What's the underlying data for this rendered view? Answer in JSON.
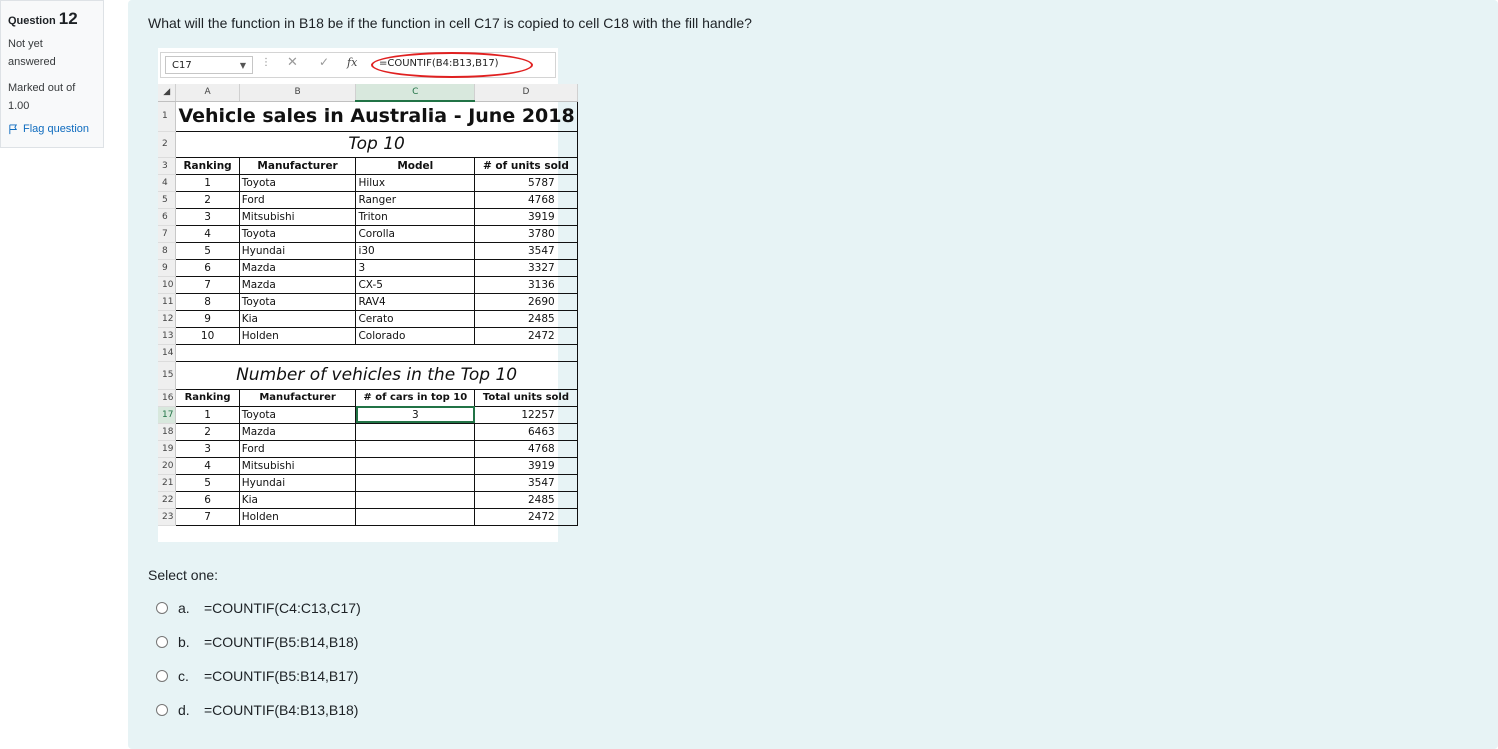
{
  "info": {
    "question_label": "Question",
    "question_number": "12",
    "state_line1": "Not yet",
    "state_line2": "answered",
    "grade_line1": "Marked out of",
    "grade_line2": "1.00",
    "flag_label": "Flag question",
    "flag_icon": "flag-icon"
  },
  "question_text": "What will the function in B18 be if the function in cell C17 is copied to cell C18 with the fill handle?",
  "excel": {
    "name_box": "C17",
    "formula": "=COUNTIF(B4:B13,B17)",
    "fx": "fx",
    "columns": [
      "A",
      "B",
      "C",
      "D"
    ],
    "title": "Vehicle sales in Australia - June 2018",
    "subtitle": "Top 10",
    "table1_headers": [
      "Ranking",
      "Manufacturer",
      "Model",
      "# of units sold"
    ],
    "table1_rows": [
      [
        "1",
        "Toyota",
        "Hilux",
        "5787"
      ],
      [
        "2",
        "Ford",
        "Ranger",
        "4768"
      ],
      [
        "3",
        "Mitsubishi",
        "Triton",
        "3919"
      ],
      [
        "4",
        "Toyota",
        "Corolla",
        "3780"
      ],
      [
        "5",
        "Hyundai",
        "i30",
        "3547"
      ],
      [
        "6",
        "Mazda",
        "3",
        "3327"
      ],
      [
        "7",
        "Mazda",
        "CX-5",
        "3136"
      ],
      [
        "8",
        "Toyota",
        "RAV4",
        "2690"
      ],
      [
        "9",
        "Kia",
        "Cerato",
        "2485"
      ],
      [
        "10",
        "Holden",
        "Colorado",
        "2472"
      ]
    ],
    "section2_title": "Number of vehicles in the Top 10",
    "table2_headers": [
      "Ranking",
      "Manufacturer",
      "# of cars in top 10",
      "Total units sold"
    ],
    "table2_rows": [
      [
        "1",
        "Toyota",
        "3",
        "12257"
      ],
      [
        "2",
        "Mazda",
        "",
        "6463"
      ],
      [
        "3",
        "Ford",
        "",
        "4768"
      ],
      [
        "4",
        "Mitsubishi",
        "",
        "3919"
      ],
      [
        "5",
        "Hyundai",
        "",
        "3547"
      ],
      [
        "6",
        "Kia",
        "",
        "2485"
      ],
      [
        "7",
        "Holden",
        "",
        "2472"
      ]
    ],
    "row_numbers": [
      "1",
      "2",
      "3",
      "4",
      "5",
      "6",
      "7",
      "8",
      "9",
      "10",
      "11",
      "12",
      "13",
      "14",
      "15",
      "16",
      "17",
      "18",
      "19",
      "20",
      "21",
      "22",
      "23"
    ],
    "selected_cell": "C17"
  },
  "select_one": "Select one:",
  "options": [
    {
      "letter": "a.",
      "text": "=COUNTIF(C4:C13,C17)"
    },
    {
      "letter": "b.",
      "text": "=COUNTIF(B5:B14,B18)"
    },
    {
      "letter": "c.",
      "text": "=COUNTIF(B5:B14,B17)"
    },
    {
      "letter": "d.",
      "text": "=COUNTIF(B4:B13,B18)"
    }
  ],
  "colors": {
    "accent": "#0f6cbf",
    "highlight": "#e02020",
    "excel_green": "#217346",
    "content_bg": "#e7f3f5"
  }
}
